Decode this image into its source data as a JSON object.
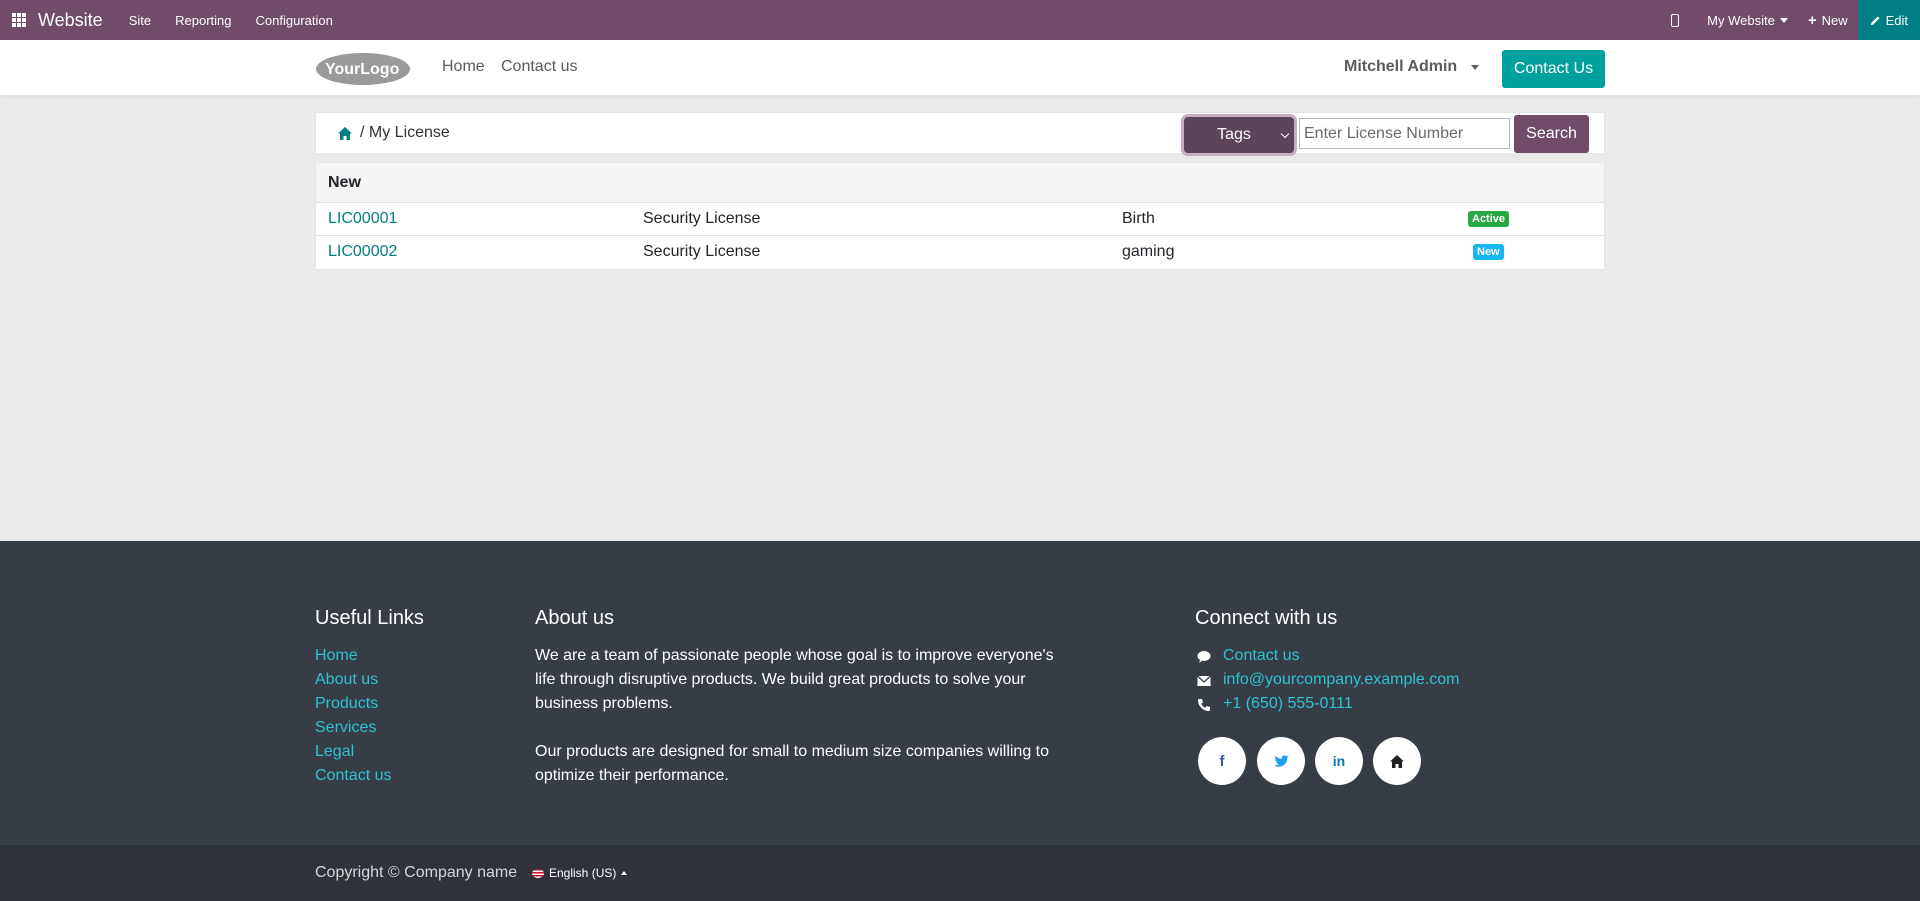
{
  "adminbar": {
    "brand": "Website",
    "menus": [
      "Site",
      "Reporting",
      "Configuration"
    ],
    "website_switch": "My Website",
    "new_label": "New",
    "edit_label": "Edit"
  },
  "header": {
    "logo_text": "YourLogo",
    "nav": [
      "Home",
      "Contact us"
    ],
    "user": "Mitchell Admin",
    "contact_button": "Contact Us"
  },
  "breadcrumb": {
    "current": "/ My License"
  },
  "search": {
    "tags_label": "Tags",
    "placeholder": "Enter License Number",
    "button": "Search"
  },
  "table": {
    "group_header": "New",
    "rows": [
      {
        "number": "LIC00001",
        "type": "Security License",
        "tag": "Birth",
        "status": "Active",
        "status_color": "#28a745"
      },
      {
        "number": "LIC00002",
        "type": "Security License",
        "tag": "gaming",
        "status": "New",
        "status_color": "#17b6f1"
      }
    ]
  },
  "footer": {
    "useful_links_title": "Useful Links",
    "useful_links": [
      "Home",
      "About us",
      "Products",
      "Services",
      "Legal",
      "Contact us"
    ],
    "about_title": "About us",
    "about_p1_lines": [
      "We are a team of passionate people whose goal is to improve everyone's",
      "life through disruptive products. We build great products to solve your",
      "business problems."
    ],
    "about_p2_lines": [
      "Our products are designed for small to medium size companies willing to",
      "optimize their performance."
    ],
    "connect_title": "Connect with us",
    "connect_contact": "Contact us",
    "connect_email": "info@yourcompany.example.com",
    "connect_phone": "+1 (650) 555-0111",
    "social": [
      "facebook-icon",
      "twitter-icon",
      "linkedin-icon",
      "home-icon"
    ]
  },
  "copyright": {
    "text": "Copyright © Company name",
    "language": "English (US)"
  },
  "colors": {
    "brand": "#714b67",
    "accent": "#00a09d",
    "link": "#017e84",
    "footer_link": "#2cc3d2"
  }
}
